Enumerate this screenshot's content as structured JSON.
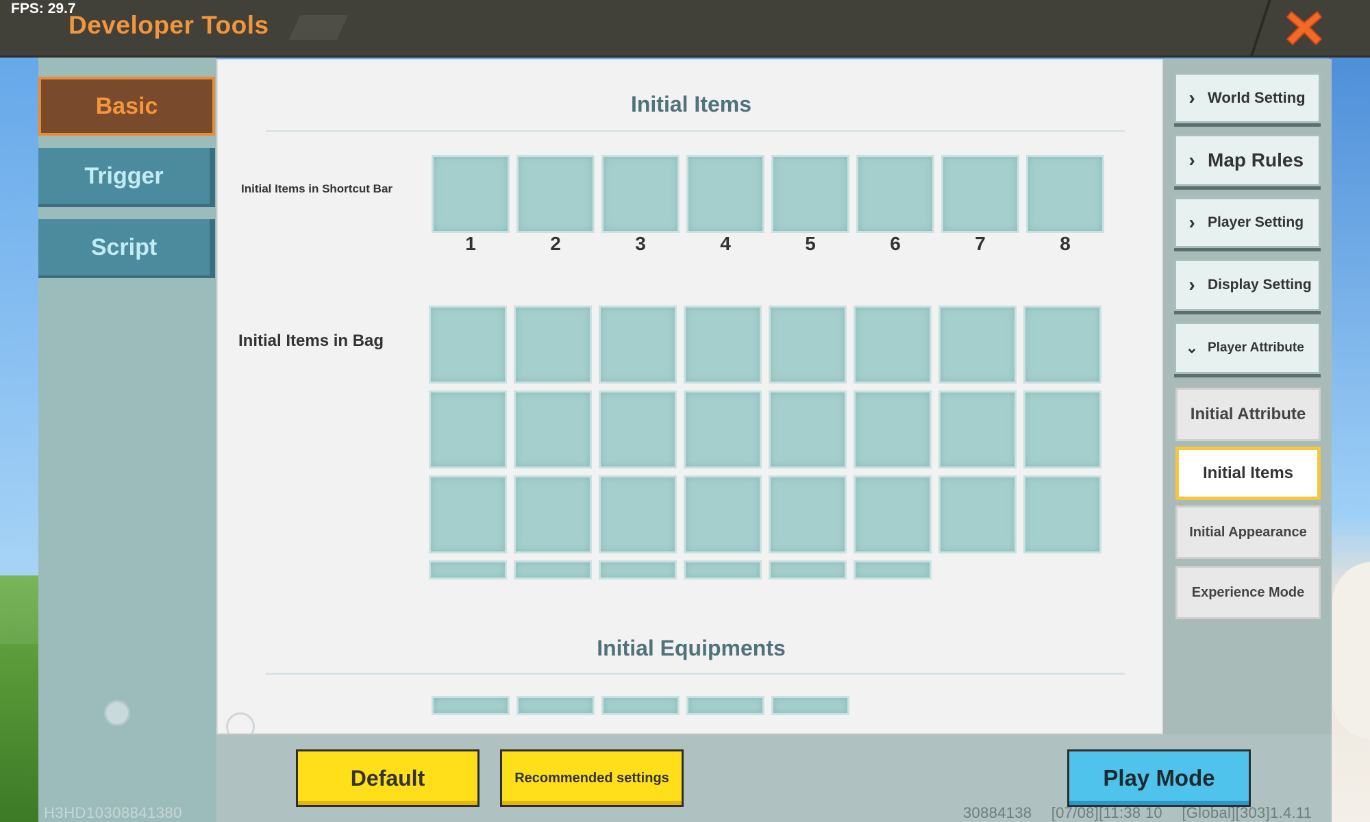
{
  "top_bar": {
    "fps": "FPS: 29.7",
    "title": "Developer Tools",
    "close_icon": "close-x-icon"
  },
  "left_tabs": {
    "items": [
      {
        "label": "Basic",
        "active": true
      },
      {
        "label": "Trigger",
        "active": false
      },
      {
        "label": "Script",
        "active": false
      }
    ]
  },
  "content": {
    "initial_items_title": "Initial Items",
    "shortcut_bar_label": "Initial Items in Shortcut Bar",
    "shortcut_slot_numbers": [
      "1",
      "2",
      "3",
      "4",
      "5",
      "6",
      "7",
      "8"
    ],
    "bag_label": "Initial Items in Bag",
    "initial_equipments_title": "Initial Equipments"
  },
  "right_nav": {
    "items": [
      {
        "label": "World Setting",
        "icon": "chevron-right-icon"
      },
      {
        "label": "Map Rules",
        "icon": "chevron-right-icon"
      },
      {
        "label": "Player Setting",
        "icon": "chevron-right-icon"
      },
      {
        "label": "Display Setting",
        "icon": "chevron-right-icon"
      },
      {
        "label": "Player Attribute",
        "icon": "chevron-down-icon",
        "expanded": true
      }
    ],
    "sub_items": [
      {
        "label": "Initial Attribute",
        "active": false
      },
      {
        "label": "Initial Items",
        "active": true
      },
      {
        "label": "Initial Appearance",
        "active": false
      },
      {
        "label": "Experience Mode",
        "active": false
      }
    ]
  },
  "bottom_bar": {
    "default_label": "Default",
    "recommended_label": "Recommended settings",
    "play_mode_label": "Play Mode"
  },
  "footer": {
    "device_id": "H3HD10308841380",
    "uid": "30884138",
    "timestamp": "[07/08][11:38 10",
    "version": "[Global][303]1.4.11"
  },
  "colors": {
    "title_orange": "#f3953b",
    "active_tab_bg": "#7a4a2c",
    "inactive_tab_bg": "#4c8b9e",
    "slot_teal": "#a4cfcd",
    "button_yellow": "#ffdf1a",
    "play_blue": "#4fc3ec",
    "highlight_gold": "#f8c63a"
  }
}
